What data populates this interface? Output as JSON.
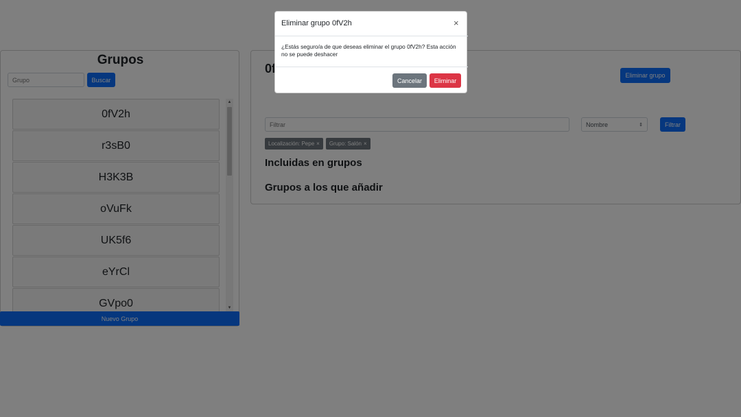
{
  "logo_text": "",
  "left_panel": {
    "title": "Grupos",
    "search_placeholder": "Grupo",
    "search_button": "Buscar",
    "groups": [
      "0fV2h",
      "r3sB0",
      "H3K3B",
      "oVuFk",
      "UK5f6",
      "eYrCl",
      "GVpo0"
    ],
    "new_group_button": "Nuevo Grupo"
  },
  "right_panel": {
    "title": "0f",
    "delete_group_button": "Eliminar grupo",
    "filter_placeholder": "Filtrar",
    "filter_select_value": "Nombre",
    "filter_button": "Filtrar",
    "tags": [
      "Localización: Pepe",
      "Grupo: Salón"
    ],
    "tag_remove_glyph": "×",
    "section_included": "Incluidas en grupos",
    "section_add": "Grupos a los que añadir"
  },
  "modal": {
    "title": "Eliminar grupo 0fV2h",
    "close_glyph": "×",
    "body": "¿Estás seguro/a de que deseas eliminar el grupo 0fV2h? Esta acción no se puede deshacer",
    "cancel_button": "Cancelar",
    "confirm_button": "Eliminar"
  },
  "colors": {
    "primary": "#0d6efd",
    "secondary": "#6c757d",
    "danger": "#dc3545"
  }
}
